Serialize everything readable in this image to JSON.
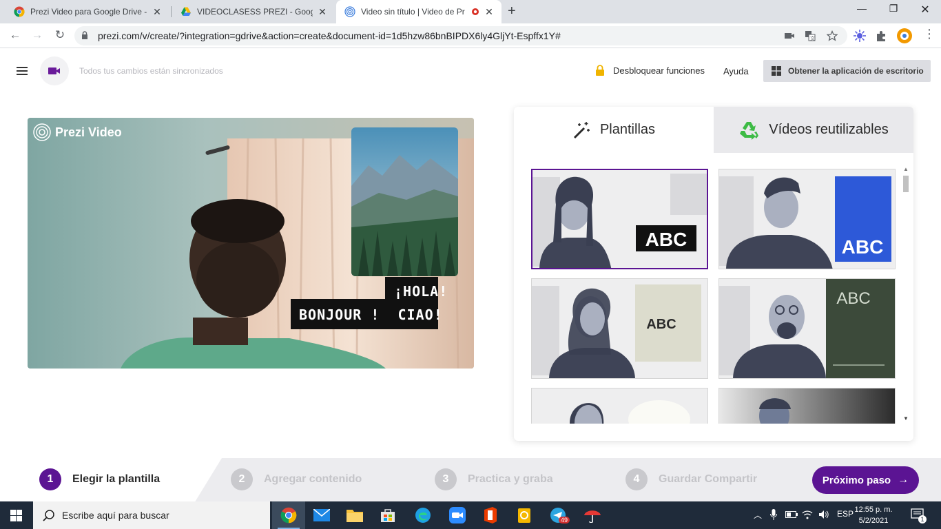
{
  "browser": {
    "tabs": [
      {
        "title": "Prezi Video para Google Drive - C",
        "active": false
      },
      {
        "title": "VIDEOCLASESS PREZI - Google D",
        "active": false
      },
      {
        "title": "Video sin título | Video de Pr",
        "active": true
      }
    ],
    "url": "prezi.com/v/create/?integration=gdrive&action=create&document-id=1d5hzw86bnBIPDX6ly4GljYt-Espffx1Y#"
  },
  "header": {
    "sync_status": "Todos tus cambios están sincronizados",
    "unlock_label": "Desbloquear funciones",
    "help_label": "Ayuda",
    "desktop_app_label": "Obtener la aplicación de escritorio"
  },
  "video": {
    "logo_text": "Prezi Video",
    "greeting_line1": "¡HOLA!",
    "greeting_line2": "BONJOUR !  CIAO!"
  },
  "panel": {
    "tab_templates": "Plantillas",
    "tab_reusable": "Vídeos reutilizables",
    "thumbnails": [
      {
        "label": "ABC"
      },
      {
        "label": "ABC"
      },
      {
        "label": "ABC"
      },
      {
        "label": "ABC"
      }
    ]
  },
  "steps": {
    "items": [
      {
        "num": "1",
        "label": "Elegir la plantilla"
      },
      {
        "num": "2",
        "label": "Agregar contenido"
      },
      {
        "num": "3",
        "label": "Practica y graba"
      },
      {
        "num": "4",
        "label": "Guardar Compartir"
      }
    ],
    "next_label": "Próximo paso"
  },
  "taskbar": {
    "search_placeholder": "Escribe aquí para buscar",
    "telegram_badge": "49",
    "language": "ESP",
    "time": "12:55 p. m.",
    "date": "5/2/2021",
    "notification_count": "1"
  },
  "colors": {
    "accent": "#5b1493",
    "taskbar": "#1f2b3a"
  }
}
